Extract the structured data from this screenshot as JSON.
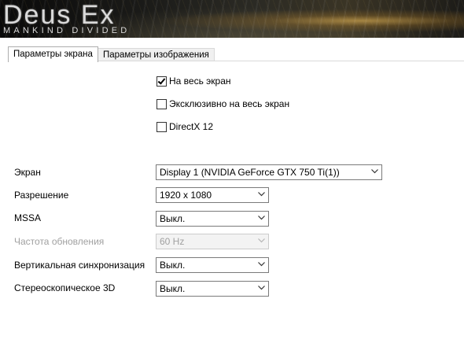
{
  "banner": {
    "logo_title": "Deus Ex",
    "logo_subtitle": "MANKIND DIVIDED"
  },
  "tabs": [
    {
      "label": "Параметры экрана",
      "active": true
    },
    {
      "label": "Параметры изображения",
      "active": false
    }
  ],
  "checkboxes": [
    {
      "label": "На весь экран",
      "checked": true
    },
    {
      "label": "Эксклюзивно на весь экран",
      "checked": false
    },
    {
      "label": "DirectX 12",
      "checked": false
    }
  ],
  "settings": [
    {
      "label": "Экран",
      "value": "Display 1 (NVIDIA GeForce GTX 750 Ti(1))",
      "enabled": true
    },
    {
      "label": "Разрешение",
      "value": "1920 x 1080",
      "enabled": true
    },
    {
      "label": "MSSA",
      "value": "Выкл.",
      "enabled": true
    },
    {
      "label": "Частота обновления",
      "value": "60 Hz",
      "enabled": false
    },
    {
      "label": "Вертикальная синхронизация",
      "value": "Выкл.",
      "enabled": true
    },
    {
      "label": "Стереоскопическое 3D",
      "value": "Выкл.",
      "enabled": true
    }
  ],
  "icons": {
    "dropdown": "chevron-down-icon",
    "check": "checkmark-icon"
  }
}
